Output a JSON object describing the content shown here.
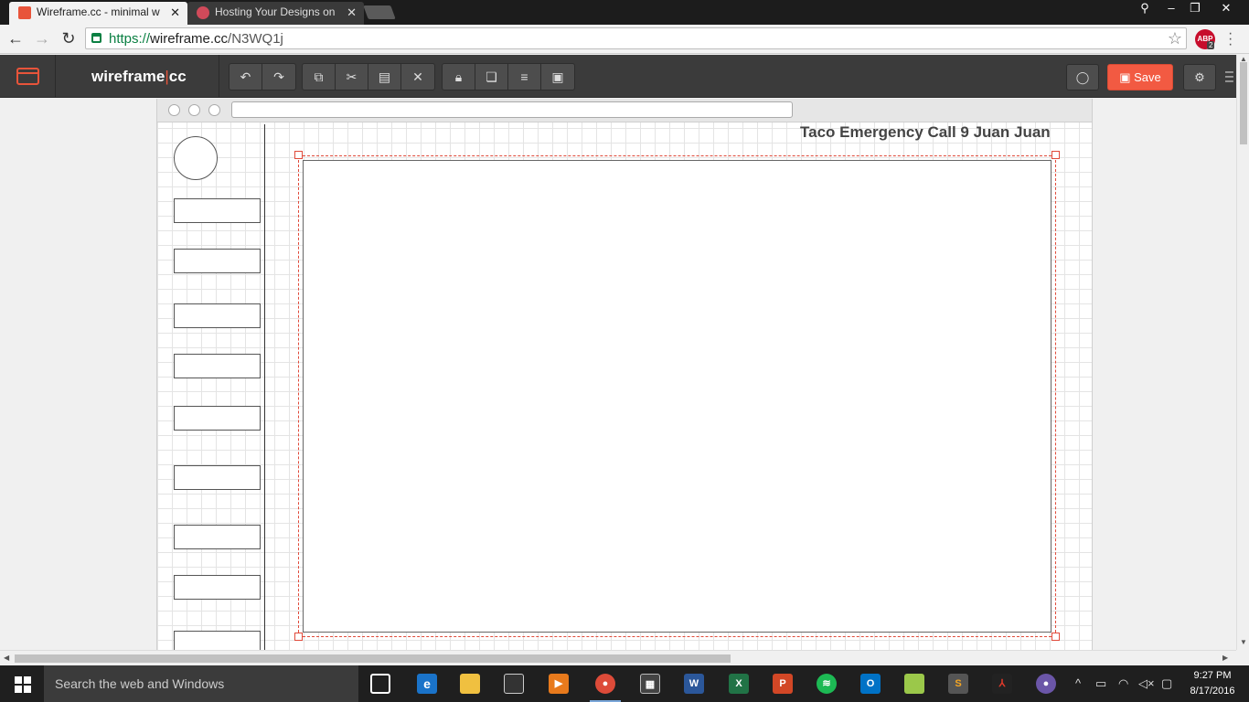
{
  "browser": {
    "tabs": [
      {
        "title": "Wireframe.cc - minimal wi",
        "active": true
      },
      {
        "title": "Hosting Your Designs on |",
        "active": false
      }
    ],
    "url": {
      "scheme": "https://",
      "domain": "wireframe.cc",
      "path": "/N3WQ1j"
    },
    "abp_label": "ABP",
    "abp_count": "2"
  },
  "app": {
    "brand_left": "wireframe",
    "brand_sep": "|",
    "brand_right": "cc",
    "save_label": "Save",
    "accent_color": "#f25a42",
    "toolbar_icons": [
      "undo-icon",
      "redo-icon",
      "copy-icon",
      "cut-icon",
      "paste-icon",
      "delete-icon",
      "lock-icon",
      "bring-front-icon",
      "align-icon",
      "group-icon"
    ]
  },
  "canvas": {
    "heading": "Taco Emergency Call 9 Juan Juan"
  },
  "taskbar": {
    "search_placeholder": "Search the web and Windows",
    "time": "9:27 PM",
    "date": "8/17/2016"
  }
}
